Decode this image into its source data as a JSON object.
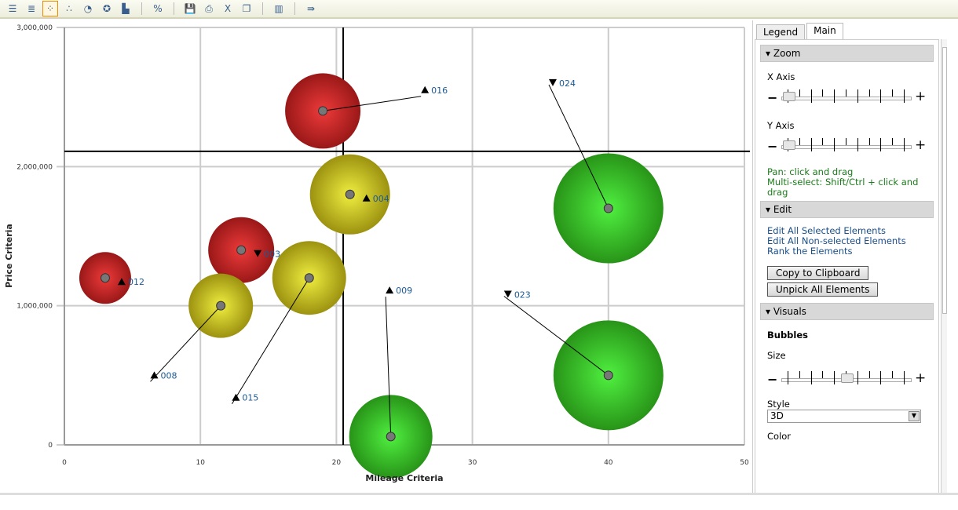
{
  "toolbar": {
    "icons": [
      "bar-chart-icon",
      "stacked-bar-icon",
      "bubble-chart-icon",
      "scatter-chart-icon",
      "pie-chart-icon",
      "radar-chart-icon",
      "step-chart-icon",
      "format-percent-icon",
      "save-icon",
      "print-icon",
      "excel-export-icon",
      "copy-window-icon",
      "report-icon",
      "pin-arrow-icon"
    ],
    "active": "bubble-chart-icon"
  },
  "panel": {
    "tabs": [
      "Legend",
      "Main"
    ],
    "active_tab": "Main",
    "zoom": {
      "title": "Zoom",
      "x_axis": "X Axis",
      "y_axis": "Y Axis",
      "x_level": 0,
      "y_level": 0,
      "hint_pan": "Pan: click and drag",
      "hint_multi": "Multi-select: Shift/Ctrl + click and drag"
    },
    "edit": {
      "title": "Edit",
      "links": [
        "Edit All Selected Elements",
        "Edit All Non-selected Elements",
        "Rank the Elements"
      ],
      "copy": "Copy to Clipboard",
      "unpick": "Unpick All Elements"
    },
    "visuals": {
      "title": "Visuals",
      "bubbles": "Bubbles",
      "size_label": "Size",
      "size_level": 0.5,
      "style_label": "Style",
      "style_value": "3D",
      "color_label": "Color"
    }
  },
  "chart_data": {
    "type": "scatter",
    "xlabel": "Mileage Criteria",
    "ylabel": "Price Criteria",
    "xlim": [
      0,
      50
    ],
    "ylim": [
      0,
      3000000
    ],
    "xticks": [
      "0",
      "10",
      "20",
      "30",
      "40",
      "50"
    ],
    "yticks": [
      "0",
      "1,000,000",
      "2,000,000",
      "3,000,000"
    ],
    "grid": true,
    "crosshair": {
      "x": 20.5,
      "y": 2110000
    },
    "colors": {
      "red": "#d42a2a",
      "yellow": "#c8c020",
      "green": "#34c424"
    },
    "points": [
      {
        "id": "016",
        "x": 19,
        "y": 2400000,
        "size": 48,
        "color": "red",
        "marker": "up",
        "label_x": 26.8,
        "label_y": 2550000
      },
      {
        "id": "004",
        "x": 21,
        "y": 1800000,
        "size": 51,
        "color": "yellow",
        "marker": "up",
        "label_x": null,
        "label_y": null
      },
      {
        "id": "024",
        "x": 40,
        "y": 1700000,
        "size": 70,
        "color": "green",
        "marker": "down",
        "label_x": 36.2,
        "label_y": 2600000
      },
      {
        "id": "003",
        "x": 13,
        "y": 1400000,
        "size": 42,
        "color": "red",
        "marker": "down",
        "label_x": null,
        "label_y": null
      },
      {
        "id": "012",
        "x": 3,
        "y": 1200000,
        "size": 33,
        "color": "red",
        "marker": "up",
        "label_x": null,
        "label_y": null
      },
      {
        "id": "015",
        "x": 18,
        "y": 1200000,
        "size": 47,
        "color": "yellow",
        "marker": "up",
        "label_x": 12.9,
        "label_y": 340000
      },
      {
        "id": "008",
        "x": 11.5,
        "y": 1000000,
        "size": 41,
        "color": "yellow",
        "marker": "up",
        "label_x": 6.9,
        "label_y": 500000
      },
      {
        "id": "009",
        "x": 24,
        "y": 60000,
        "size": 53,
        "color": "green",
        "marker": "up",
        "label_x": 24.2,
        "label_y": 1110000
      },
      {
        "id": "023",
        "x": 40,
        "y": 500000,
        "size": 70,
        "color": "green",
        "marker": "down",
        "label_x": 32.9,
        "label_y": 1080000
      }
    ]
  }
}
